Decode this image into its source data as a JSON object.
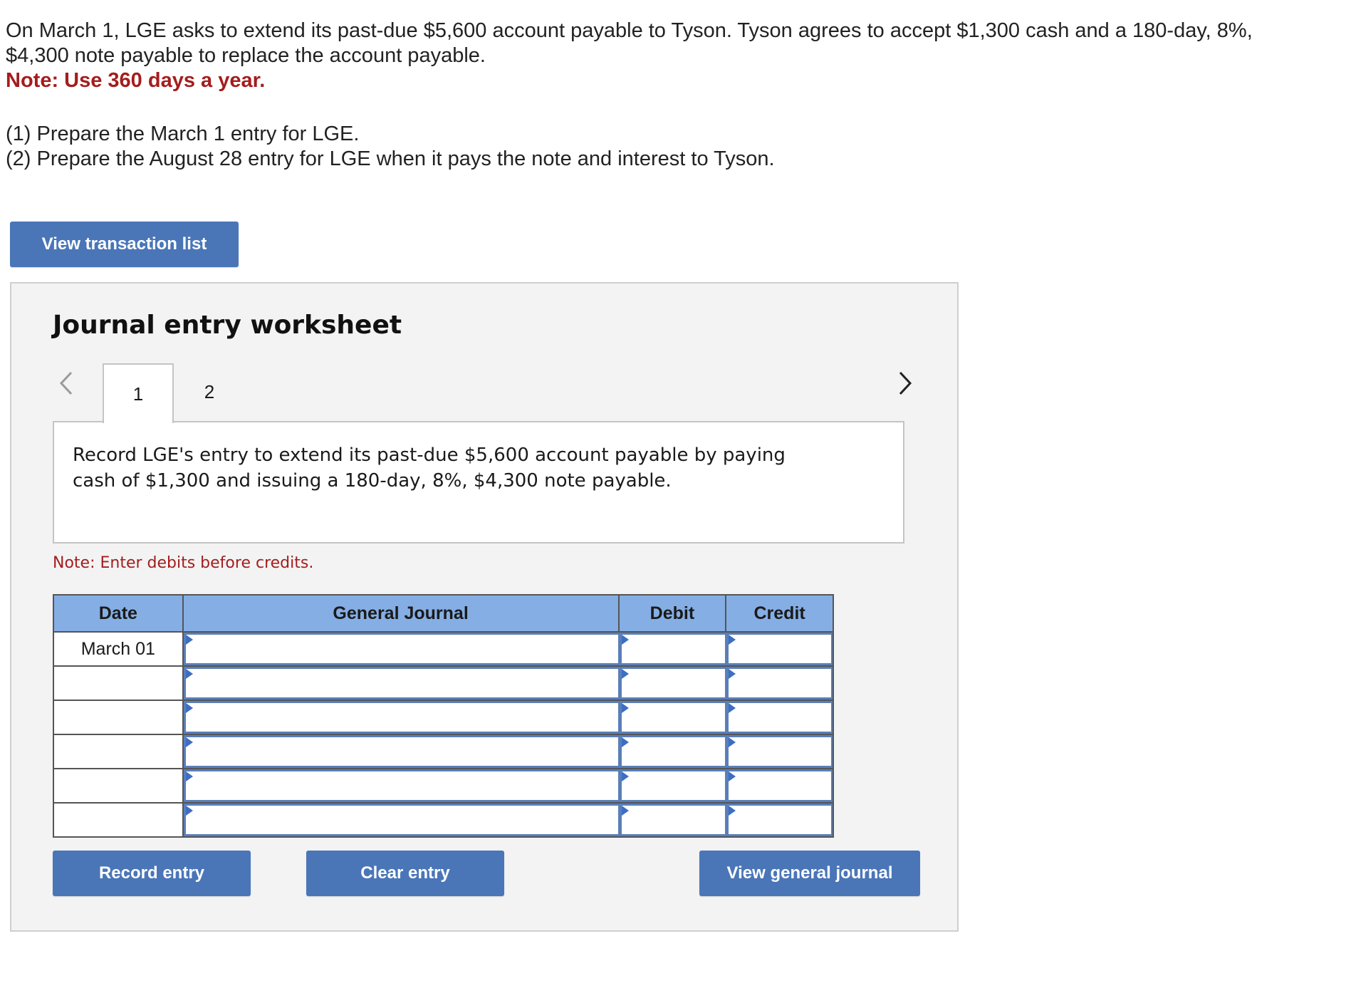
{
  "intro": {
    "line1": "On March 1, LGE asks to extend its past-due $5,600 account payable to Tyson. Tyson agrees to accept $1,300 cash and a 180-day, 8%,",
    "line2": "$4,300 note payable to replace the account payable.",
    "note": "Note: Use 360 days a year.",
    "req1": "(1) Prepare the March 1 entry for LGE.",
    "req2": "(2) Prepare the August 28 entry for LGE when it pays the note and interest to Tyson."
  },
  "buttons": {
    "view_transaction_list": "View transaction list",
    "record_entry": "Record entry",
    "clear_entry": "Clear entry",
    "view_general_journal": "View general journal"
  },
  "worksheet": {
    "title": "Journal entry worksheet",
    "tabs": [
      "1",
      "2"
    ],
    "active_tab": "1",
    "prompt": "Record LGE's entry to extend its past-due $5,600 account payable by paying cash of $1,300 and issuing a 180-day, 8%, $4,300 note payable.",
    "note": "Note: Enter debits before credits."
  },
  "journal": {
    "headers": {
      "date": "Date",
      "general_journal": "General Journal",
      "debit": "Debit",
      "credit": "Credit"
    },
    "rows": [
      {
        "date": "March 01"
      },
      {
        "date": ""
      },
      {
        "date": ""
      },
      {
        "date": ""
      },
      {
        "date": ""
      },
      {
        "date": ""
      }
    ]
  },
  "colors": {
    "button": "#4a76b8",
    "header": "#85aee4",
    "note": "#a41d1d"
  }
}
